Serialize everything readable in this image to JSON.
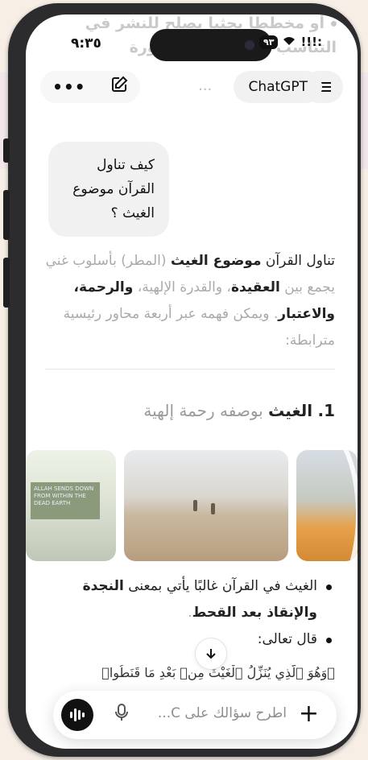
{
  "status": {
    "time": "٩:٣٥",
    "battery": "٩٣",
    "wifi": "▲",
    "signal": "!!!:"
  },
  "faded_top_text": "أو مخططا بحثيا يصلح للنشر في التناسب الموضوعي للسورة",
  "header": {
    "title": "ChatGPT",
    "more_label": "•••",
    "menu_label": "menu",
    "dots": "..."
  },
  "user_message": "كيف تناول القرآن موضوع الغيث ؟",
  "answer": {
    "p1": "تناول القرآن",
    "p1_bold": "موضوع الغيث",
    "p1_rest": "(المطر) بأسلوب غني يجمع بين",
    "p1_bold2": "العقيدة",
    "p1_rest2": "، والقدرة الإلهية،",
    "p1_bold3": "والرحمة، والاعتبار",
    "p1_rest3": ". ويمكن فهمه عبر أربعة محاور رئيسية مترابطة:"
  },
  "heading": {
    "number": "1.",
    "bold": "الغيث",
    "rest": "بوصفه رحمة إلهية"
  },
  "images": {
    "img1_sign": "ALLAH SENDS DOWN FROM WITHIN THE DEAD EARTH"
  },
  "bullets": [
    {
      "pre": "الغيث في القرآن غالبًا يأتي بمعنى ",
      "bold": "النجدة والإنقاذ بعد القحط",
      "post": "."
    },
    {
      "pre": "قال تعالى:",
      "bold": "",
      "post": ""
    }
  ],
  "verse": "﴿وَهُوَ ٱلَّذِي يُنَزِّلُ ٱلْغَيْثَ مِنۢ بَعْدِ مَا قَنَطُوا﴾",
  "composer": {
    "placeholder": "اطرح سؤالك على C...",
    "plus": "+"
  },
  "icons": {
    "scroll": "chevron-down-icon",
    "mic": "microphone-icon",
    "voice": "voice-mode-icon",
    "edit": "new-chat-icon",
    "speaker": "speaker-icon"
  }
}
